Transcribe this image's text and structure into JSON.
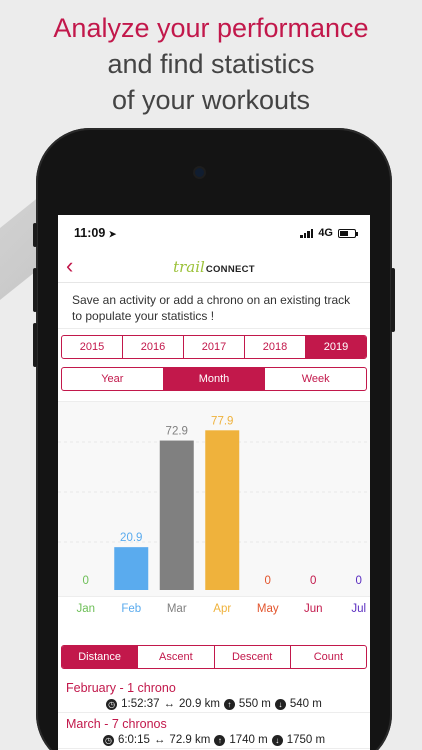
{
  "headline": {
    "line1": "Analyze your performance",
    "line2": "and find statistics",
    "line3": "of your workouts"
  },
  "status_bar": {
    "time": "11:09",
    "network": "4G"
  },
  "app": {
    "logo_script": "trail",
    "logo_caps": "CONNECT",
    "info_text": "Save an activity or add a chrono on an existing track to populate your statistics !"
  },
  "years": {
    "options": [
      "2015",
      "2016",
      "2017",
      "2018",
      "2019"
    ],
    "selected": "2019"
  },
  "period": {
    "options": [
      "Year",
      "Month",
      "Week"
    ],
    "selected": "Month"
  },
  "colors": {
    "accent": "#c2184b",
    "green": "#6dbf57",
    "blue": "#5aabee",
    "gray": "#808080",
    "orange": "#efb23c",
    "red": "#e2542c",
    "purple": "#5a2cc0"
  },
  "chart_data": {
    "type": "bar",
    "categories": [
      "Jan",
      "Feb",
      "Mar",
      "Apr",
      "May",
      "Jun",
      "Jul"
    ],
    "values": [
      0,
      20.9,
      72.9,
      77.9,
      0,
      0,
      0
    ],
    "value_labels": [
      "0",
      "20.9",
      "72.9",
      "77.9",
      "0",
      "0",
      "0"
    ],
    "bar_colors": [
      "#6dbf57",
      "#5aabee",
      "#808080",
      "#efb23c",
      "#e2542c",
      "#c2184b",
      "#5a2cc0"
    ],
    "ylim": [
      0,
      80
    ],
    "grid": true
  },
  "metrics": {
    "options": [
      "Distance",
      "Ascent",
      "Descent",
      "Count"
    ],
    "selected": "Distance"
  },
  "list": [
    {
      "title": "February - 1 chrono",
      "duration": "1:52:37",
      "distance": "20.9 km",
      "ascent": "550 m",
      "descent": "540 m"
    },
    {
      "title": "March - 7 chronos",
      "duration": "6:0:15",
      "distance": "72.9 km",
      "ascent": "1740 m",
      "descent": "1750 m"
    }
  ]
}
